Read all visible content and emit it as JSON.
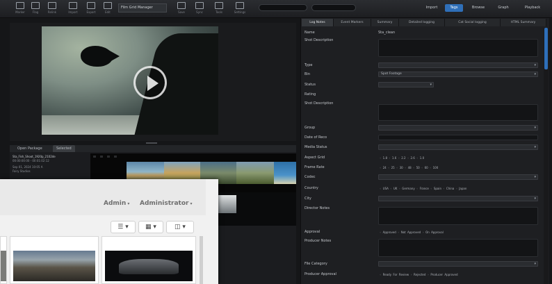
{
  "toolbar": {
    "buttons": [
      {
        "label": "Marker",
        "icon": "marker-icon"
      },
      {
        "label": "Flag",
        "icon": "flag-icon"
      },
      {
        "label": "Relink",
        "icon": "relink-icon"
      },
      {
        "label": "Import",
        "icon": "import-icon"
      },
      {
        "label": "Export",
        "icon": "export-icon"
      },
      {
        "label": "Edit",
        "icon": "edit-icon"
      },
      {
        "label": "Save",
        "icon": "save-icon"
      },
      {
        "label": "Sync",
        "icon": "sync-icon"
      },
      {
        "label": "Tools",
        "icon": "tools-icon"
      },
      {
        "label": "Settings",
        "icon": "gear-icon"
      }
    ],
    "dropdown_value": "Film Grid Manager",
    "tabs": [
      "Import",
      "Tags",
      "Browse",
      "Graph",
      "Playback"
    ],
    "active_tab": 1
  },
  "video": {
    "bin_tabs": [
      "Open Package",
      "Selected"
    ],
    "clip_name": "Sta_Fish_Shoot_1920p_2102de",
    "clip_lines": [
      "00:00:00:00 - 00:01:02:12",
      "Sep 01, 2024 10:05 A",
      "Fairy Studios"
    ]
  },
  "metadata": {
    "tabs": [
      "Log Notes",
      "Event Markers",
      "Summary",
      "Detailed logging",
      "Cat Social logging",
      "HTML Summary"
    ],
    "active_tab": 0,
    "fields": {
      "name_label": "Name",
      "name_value": "Sta_clean",
      "shot_desc_label": "Shot Description",
      "type_label": "Type",
      "bin_label": "Bin",
      "bin_value": "Spot Footage",
      "status_label": "Status",
      "rating_label": "Rating",
      "shot_description_label": "Shot Description",
      "group_label": "Group",
      "date_label": "Date of Reco",
      "media_status_label": "Media Status",
      "aspect_label": "Aspect Grid",
      "frame_rate_label": "Frame Rate",
      "codec_label": "Codec",
      "country_label": "Country",
      "city_label": "City",
      "director_notes_label": "Director Notes",
      "approval_label": "Approval",
      "producer_notes_label": "Producer Notes",
      "file_label": "File Category",
      "producer_approval_label": "Producer Approval"
    },
    "aspect_options": [
      "1.8",
      "1.6",
      "2.2",
      "2.6",
      "1.0"
    ],
    "frame_rate_options": [
      "24",
      "25",
      "30",
      "48",
      "50",
      "60",
      "100"
    ],
    "country_options": [
      "USA",
      "UK",
      "Germany",
      "France",
      "Spain",
      "China",
      "Japan"
    ],
    "approval_options": [
      "Approved",
      "Not Approved",
      "On Approval"
    ],
    "producer_approval_options": [
      "Ready For Review",
      "Rejected",
      "Producer Approved"
    ]
  },
  "web": {
    "admin_menu": "Admin",
    "admin_user": "Administrator",
    "view_buttons": [
      "☰",
      "▦",
      "◫"
    ]
  }
}
